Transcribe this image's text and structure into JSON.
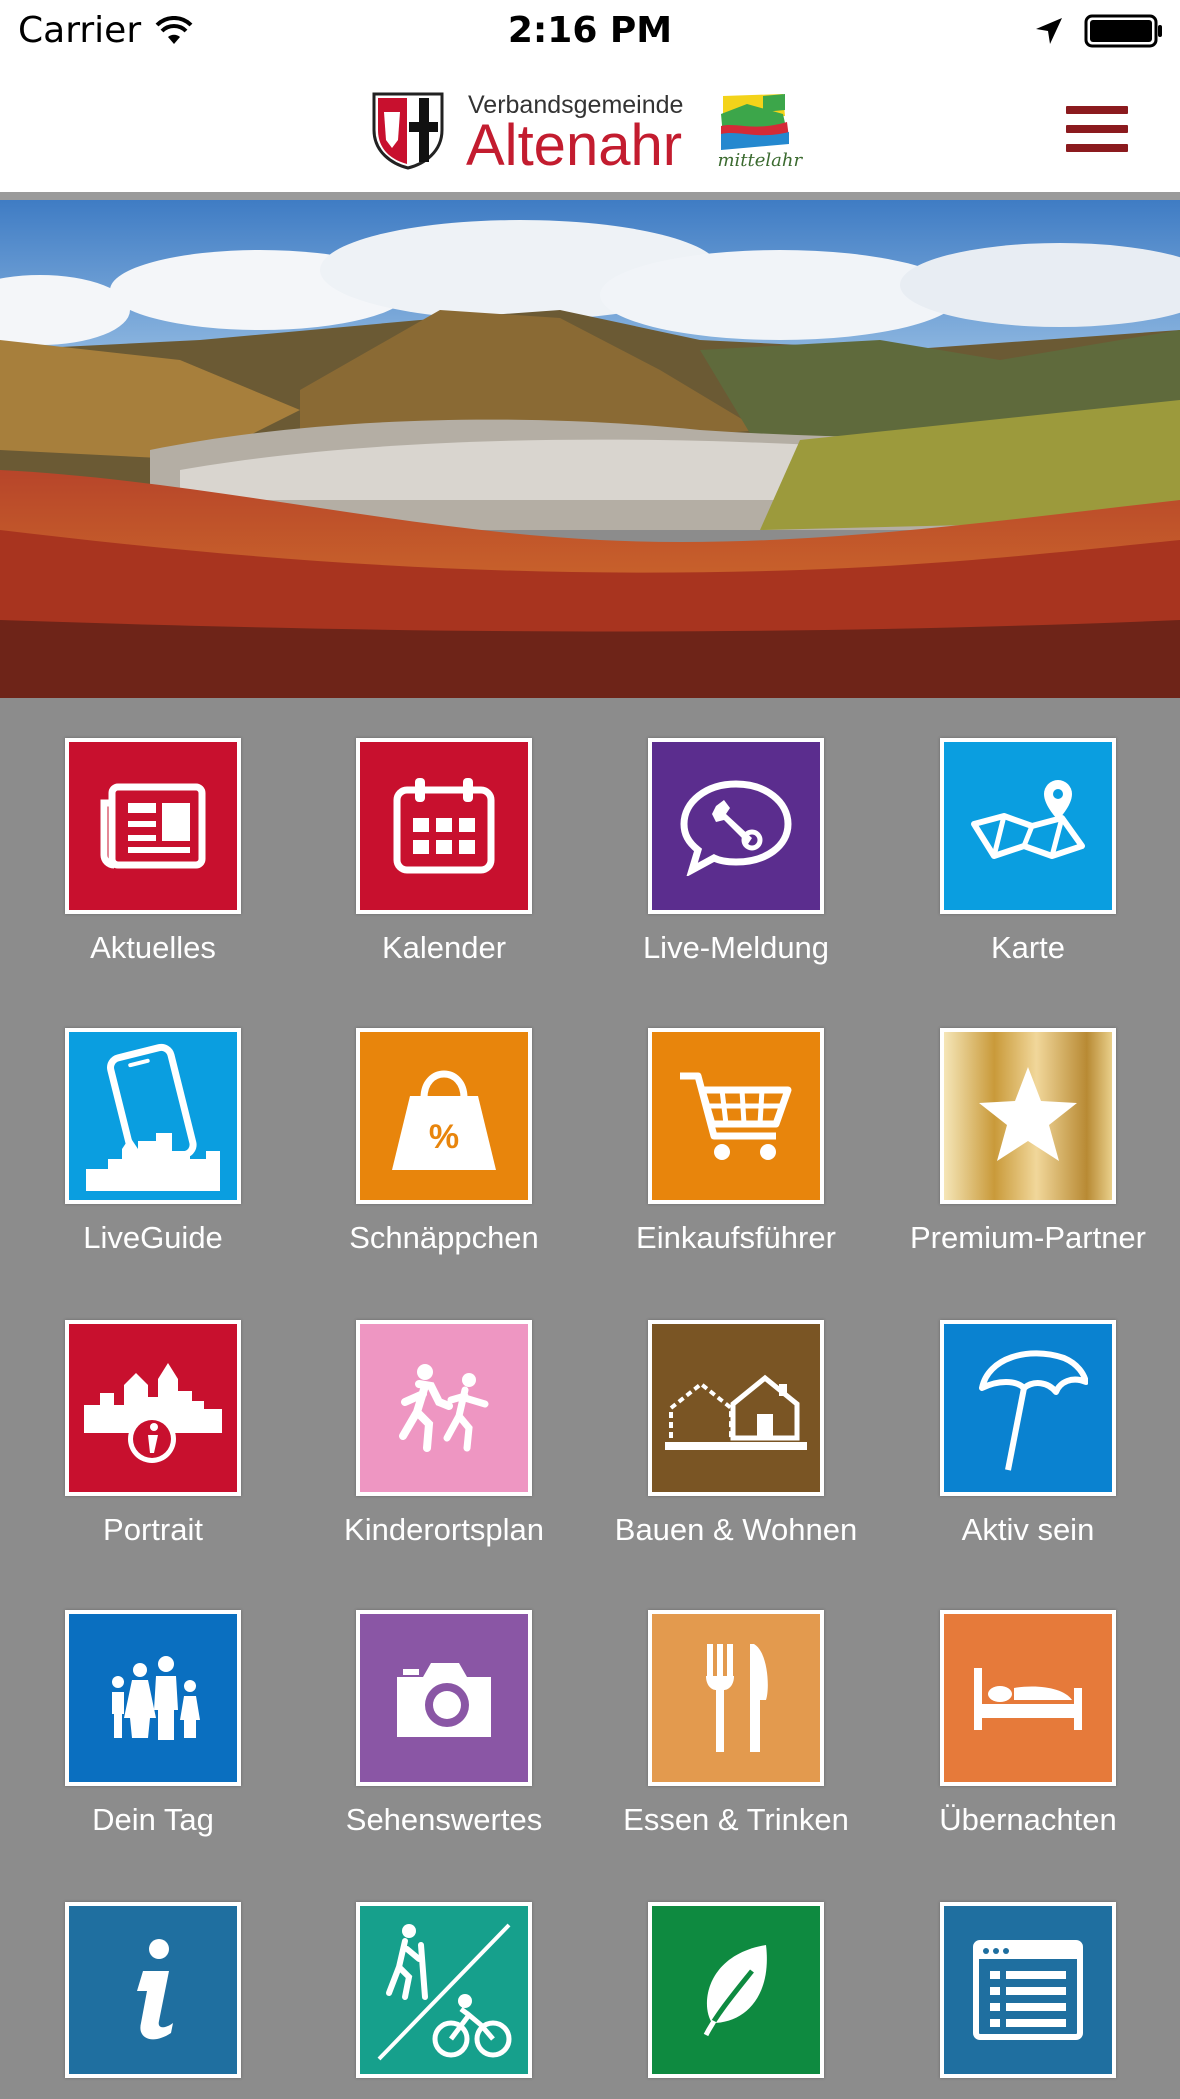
{
  "status_bar": {
    "carrier": "Carrier",
    "time": "2:16 PM"
  },
  "header": {
    "logo_subtitle": "Verbandsgemeinde",
    "logo_title": "Altenahr",
    "partner_logo_text": "mittelahr"
  },
  "colors": {
    "brand_red": "#c31c2f",
    "menu_red": "#8b1a1e",
    "background": "#8c8c8c"
  },
  "tiles": [
    {
      "label": "Aktuelles",
      "icon": "newspaper-icon",
      "color": "#c8102e"
    },
    {
      "label": "Kalender",
      "icon": "calendar-icon",
      "color": "#c8102e"
    },
    {
      "label": "Live-Meldung",
      "icon": "wrench-chat-icon",
      "color": "#5b2d8e"
    },
    {
      "label": "Karte",
      "icon": "map-pin-icon",
      "color": "#0a9ee0"
    },
    {
      "label": "LiveGuide",
      "icon": "phone-city-icon",
      "color": "#0a9ee0"
    },
    {
      "label": "Schnäppchen",
      "icon": "shopping-bag-icon",
      "color": "#e8850c"
    },
    {
      "label": "Einkaufsführer",
      "icon": "cart-icon",
      "color": "#e8850c"
    },
    {
      "label": "Premium-Partner",
      "icon": "star-icon",
      "color": "#d4a64a"
    },
    {
      "label": "Portrait",
      "icon": "town-info-icon",
      "color": "#c8102e"
    },
    {
      "label": "Kinderortsplan",
      "icon": "kids-running-icon",
      "color": "#ee96c2"
    },
    {
      "label": "Bauen & Wohnen",
      "icon": "houses-icon",
      "color": "#7a5524"
    },
    {
      "label": "Aktiv sein",
      "icon": "parasol-icon",
      "color": "#0a82d0"
    },
    {
      "label": "Dein Tag",
      "icon": "family-icon",
      "color": "#0a6fc0"
    },
    {
      "label": "Sehenswertes",
      "icon": "camera-icon",
      "color": "#8a56a5"
    },
    {
      "label": "Essen & Trinken",
      "icon": "fork-knife-icon",
      "color": "#e39a4e"
    },
    {
      "label": "Übernachten",
      "icon": "bed-icon",
      "color": "#e67a3a"
    },
    {
      "label": "",
      "icon": "info-icon",
      "color": "#1f6fa0"
    },
    {
      "label": "",
      "icon": "hike-bike-icon",
      "color": "#16a08c"
    },
    {
      "label": "",
      "icon": "leaf-icon",
      "color": "#0e8a40"
    },
    {
      "label": "",
      "icon": "document-icon",
      "color": "#1f6fa0"
    }
  ]
}
